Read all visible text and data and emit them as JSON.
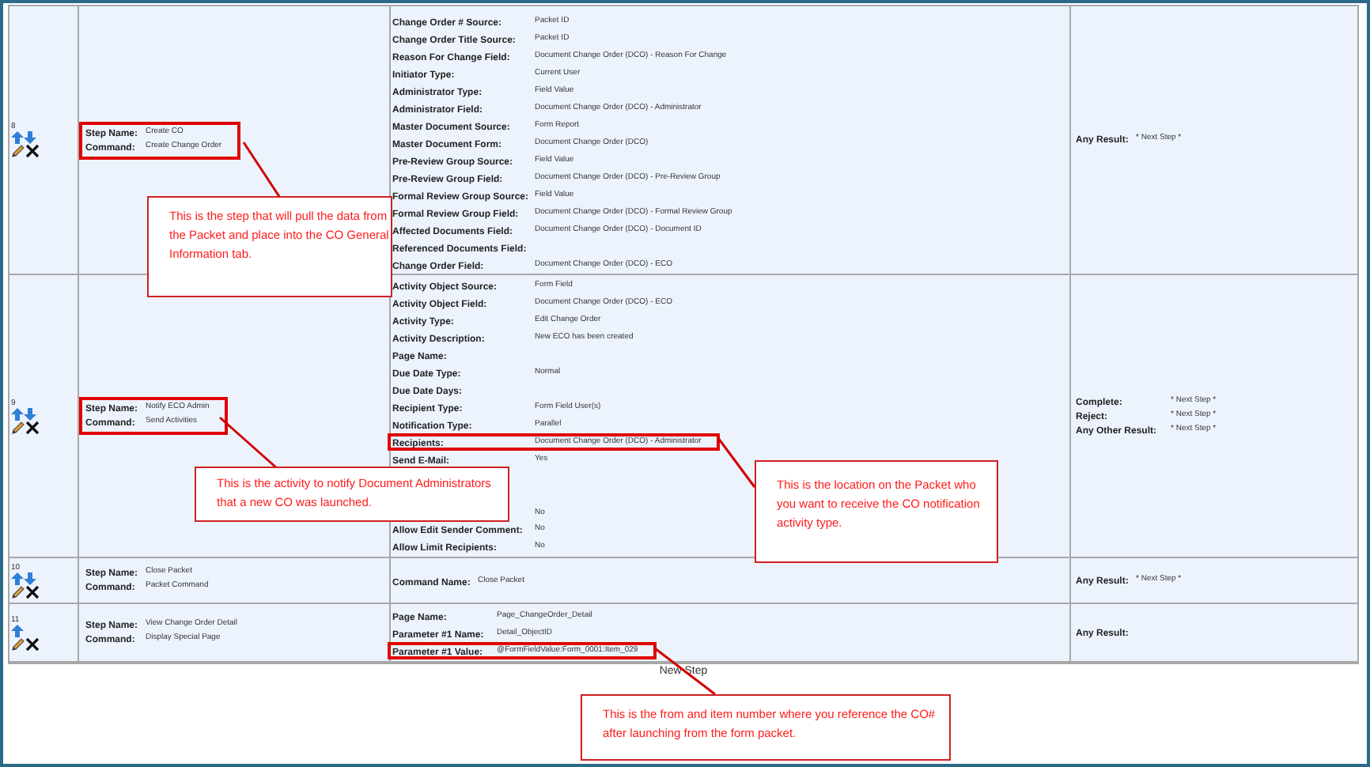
{
  "steps": [
    {
      "number": "8",
      "move_up": true,
      "move_down": true,
      "highlighted": true,
      "step_name": {
        "label": "Step Name:",
        "value": "Create CO"
      },
      "command": {
        "label": "Command:",
        "value": "Create Change Order"
      },
      "parameters": [
        {
          "label": "Change Order # Source:",
          "value": "Packet ID",
          "highlighted": false
        },
        {
          "label": "Change Order Title Source:",
          "value": "Packet ID",
          "highlighted": false
        },
        {
          "label": "Reason For Change Field:",
          "value": "Document Change Order (DCO) - Reason For Change",
          "highlighted": false
        },
        {
          "label": "Initiator Type:",
          "value": "Current User",
          "highlighted": false
        },
        {
          "label": "Administrator Type:",
          "value": "Field Value",
          "highlighted": false
        },
        {
          "label": "Administrator Field:",
          "value": "Document Change Order (DCO) - Administrator",
          "highlighted": false
        },
        {
          "label": "Master Document Source:",
          "value": "Form Report",
          "highlighted": false
        },
        {
          "label": "Master Document Form:",
          "value": "Document Change Order (DCO)",
          "highlighted": false
        },
        {
          "label": "Pre-Review Group Source:",
          "value": "Field Value",
          "highlighted": false
        },
        {
          "label": "Pre-Review Group Field:",
          "value": "Document Change Order (DCO) - Pre-Review Group",
          "highlighted": false
        },
        {
          "label": "Formal Review Group Source:",
          "value": "Field Value",
          "highlighted": false
        },
        {
          "label": "Formal Review Group Field:",
          "value": "Document Change Order (DCO) - Formal Review Group",
          "highlighted": false
        },
        {
          "label": "Affected Documents Field:",
          "value": "Document Change Order (DCO) - Document ID",
          "highlighted": false
        },
        {
          "label": "Referenced Documents Field:",
          "highlighted": false
        },
        {
          "label": "Change Order Field:",
          "value": "Document Change Order (DCO) - ECO",
          "highlighted": false
        }
      ],
      "results": [
        {
          "label": "Any Result:",
          "value": "* Next Step *"
        }
      ]
    },
    {
      "number": "9",
      "move_up": true,
      "move_down": true,
      "highlighted": true,
      "step_name": {
        "label": "Step Name:",
        "value": "Notify ECO Admin"
      },
      "command": {
        "label": "Command:",
        "value": "Send Activities"
      },
      "parameters": [
        {
          "label": "Activity Object Source:",
          "value": "Form Field",
          "highlighted": false
        },
        {
          "label": "Activity Object Field:",
          "value": "Document Change Order (DCO) - ECO",
          "highlighted": false
        },
        {
          "label": "Activity Type:",
          "value": "Edit Change Order",
          "highlighted": false
        },
        {
          "label": "Activity Description:",
          "value": "New ECO has been created",
          "highlighted": false
        },
        {
          "label": "Page Name:",
          "highlighted": false
        },
        {
          "label": "Due Date Type:",
          "value": "Normal",
          "highlighted": false
        },
        {
          "label": "Due Date Days:",
          "highlighted": false
        },
        {
          "label": "Recipient Type:",
          "value": "Form Field User(s)",
          "highlighted": false
        },
        {
          "label": "Notification Type:",
          "value": "Parallel",
          "highlighted": false
        },
        {
          "label": "Recipients:",
          "value": "Document Change Order (DCO) - Administrator",
          "highlighted": true
        },
        {
          "label": "Send E-Mail:",
          "value": "Yes",
          "highlighted": false
        },
        {
          "value": "No",
          "highlighted": false
        },
        {
          "label": "Allow Edit Sender Comment:",
          "value": "No",
          "highlighted": false
        },
        {
          "label": "Allow Limit Recipients:",
          "value": "No",
          "highlighted": false
        }
      ],
      "results": [
        {
          "label": "Complete:",
          "value": "* Next Step *"
        },
        {
          "label": "Reject:",
          "value": "* Next Step *"
        },
        {
          "label": "Any Other Result:",
          "value": "* Next Step *"
        }
      ]
    },
    {
      "number": "10",
      "move_up": true,
      "move_down": true,
      "highlighted": false,
      "step_name": {
        "label": "Step Name:",
        "value": "Close Packet"
      },
      "command": {
        "label": "Command:",
        "value": "Packet Command"
      },
      "parameters": [
        {
          "label": "Command Name:",
          "value": "Close Packet",
          "highlighted": false
        }
      ],
      "results": [
        {
          "label": "Any Result:",
          "value": "* Next Step *"
        }
      ]
    },
    {
      "number": "11",
      "move_up": true,
      "move_down": false,
      "highlighted": false,
      "step_name": {
        "label": "Step Name:",
        "value": "View Change Order Detail"
      },
      "command": {
        "label": "Command:",
        "value": "Display Special Page"
      },
      "parameters": [
        {
          "label": "Page Name:",
          "value": "Page_ChangeOrder_Detail",
          "highlighted": false
        },
        {
          "label": "Parameter #1 Name:",
          "value": "Detail_ObjectID",
          "highlighted": false
        },
        {
          "label": "Parameter #1 Value:",
          "value": "@FormFieldValue:Form_0001:Item_029",
          "highlighted": true
        }
      ],
      "results": [
        {
          "label": "Any Result:"
        }
      ]
    }
  ],
  "footer": "New Step",
  "callouts": [
    {
      "text": "This is the step that will pull the data from the Packet and place into the CO General Information tab."
    },
    {
      "text": "This is the activity to notify Document Administrators that a new CO was launched."
    },
    {
      "text": "This is the location on the Packet who you want to receive the CO notification activity type."
    },
    {
      "text": "This is the from and item number where you reference the CO# after launching from the form packet."
    }
  ]
}
